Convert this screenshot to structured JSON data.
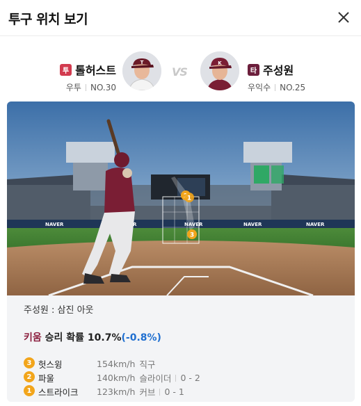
{
  "header": {
    "title": "투구 위치 보기"
  },
  "matchup": {
    "pitcher": {
      "badge": "투",
      "name": "톨허스트",
      "hand": "우투",
      "number": "NO.30"
    },
    "vs": "VS",
    "batter": {
      "badge": "타",
      "name": "주성원",
      "hand": "우익수",
      "number": "NO.25"
    }
  },
  "scene": {
    "pitch_markers": [
      "3",
      "2",
      "1"
    ],
    "signs": [
      "NAVER",
      "NAVER",
      "NAVER",
      "NAVER",
      "NAVER"
    ]
  },
  "summary": {
    "result": "주성원 : 삼진 아웃",
    "prob_team": "키움",
    "prob_label": "승리 확률",
    "prob_value": "10.7%",
    "prob_delta": "(-0.8%)"
  },
  "pitches": [
    {
      "num": "3",
      "label": "헛스윙",
      "speed": "154km/h",
      "type": "직구",
      "count": ""
    },
    {
      "num": "2",
      "label": "파울",
      "speed": "140km/h",
      "type": "슬라이더",
      "count": "0 - 2"
    },
    {
      "num": "1",
      "label": "스트라이크",
      "speed": "123km/h",
      "type": "커브",
      "count": "0 - 1"
    }
  ],
  "colors": {
    "ball_marker": "#f2a51b",
    "pitcher_badge": "#d23b4f",
    "batter_badge": "#6c1f3c",
    "delta": "#1f6fd0"
  }
}
